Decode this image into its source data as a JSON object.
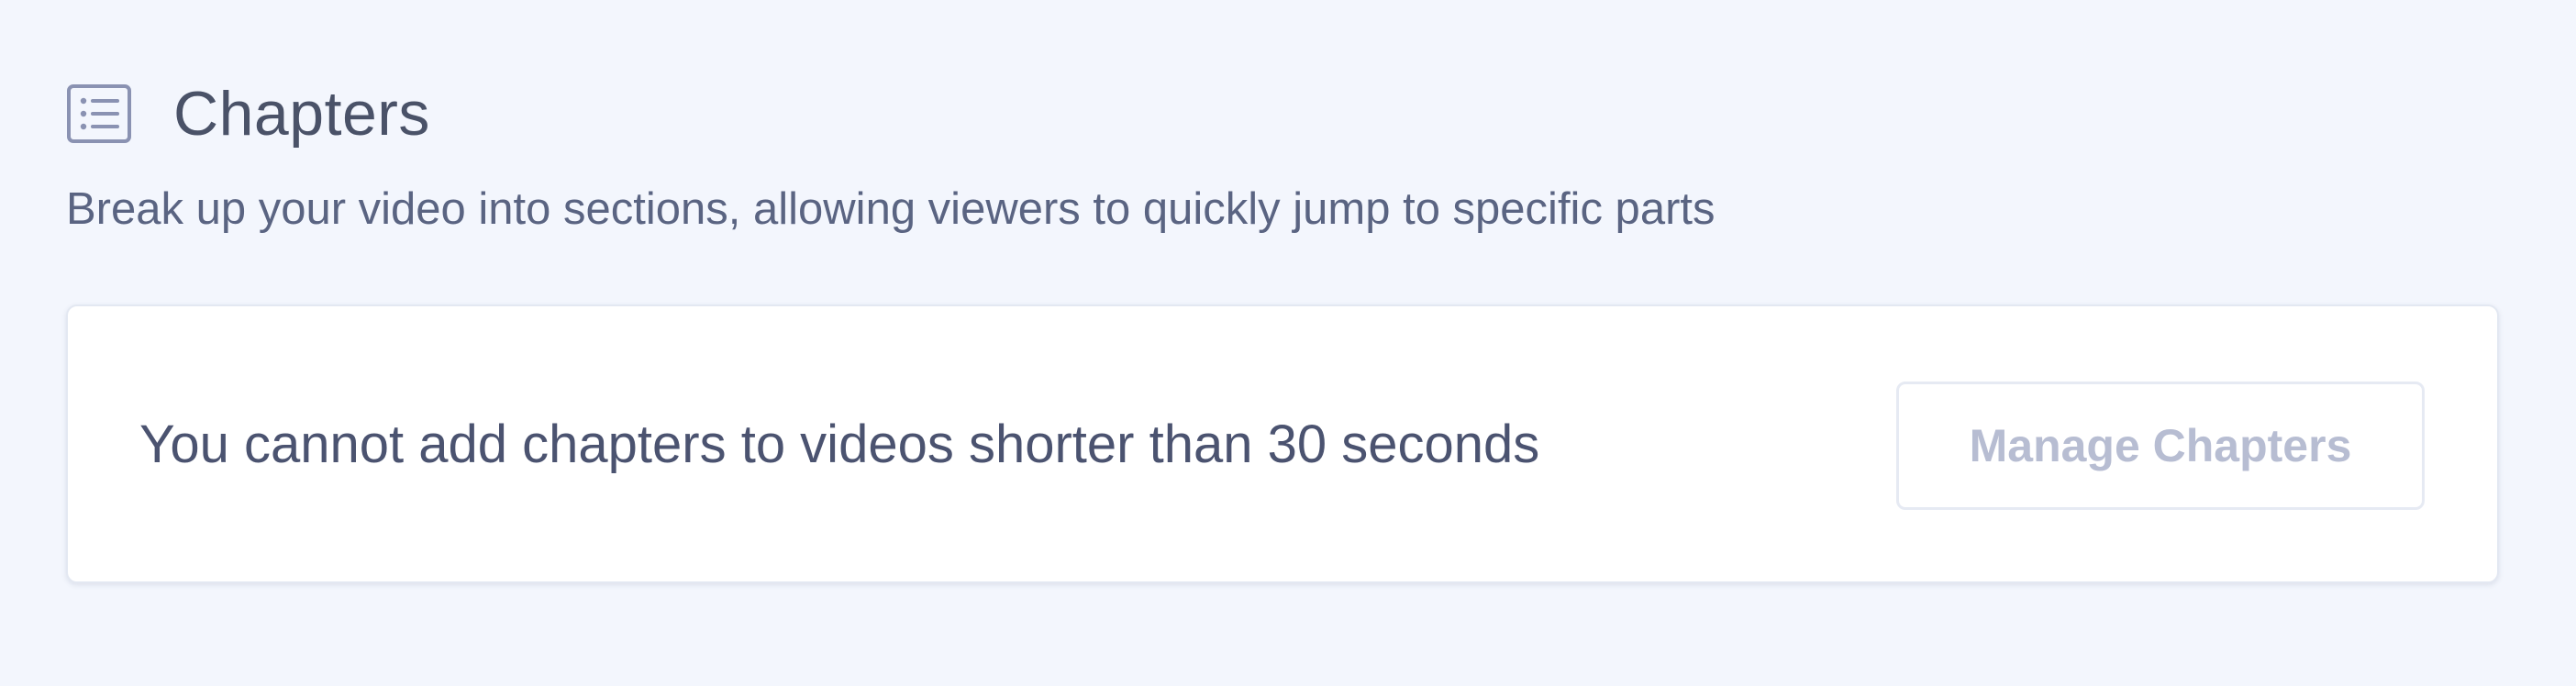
{
  "chapters_section": {
    "icon": "list-icon",
    "title": "Chapters",
    "subtitle": "Break up your video into sections, allowing viewers to quickly jump to specific parts",
    "card": {
      "message": "You cannot add chapters to videos shorter than 30 seconds",
      "manage_button_label": "Manage Chapters",
      "manage_button_state": "disabled"
    }
  },
  "colors": {
    "page_background": "#f3f6fd",
    "title_text": "#4a5268",
    "subtitle_text": "#5a6482",
    "card_background": "#ffffff",
    "disabled_button_text": "#b7bdd2",
    "icon_stroke": "#8a92b2"
  }
}
